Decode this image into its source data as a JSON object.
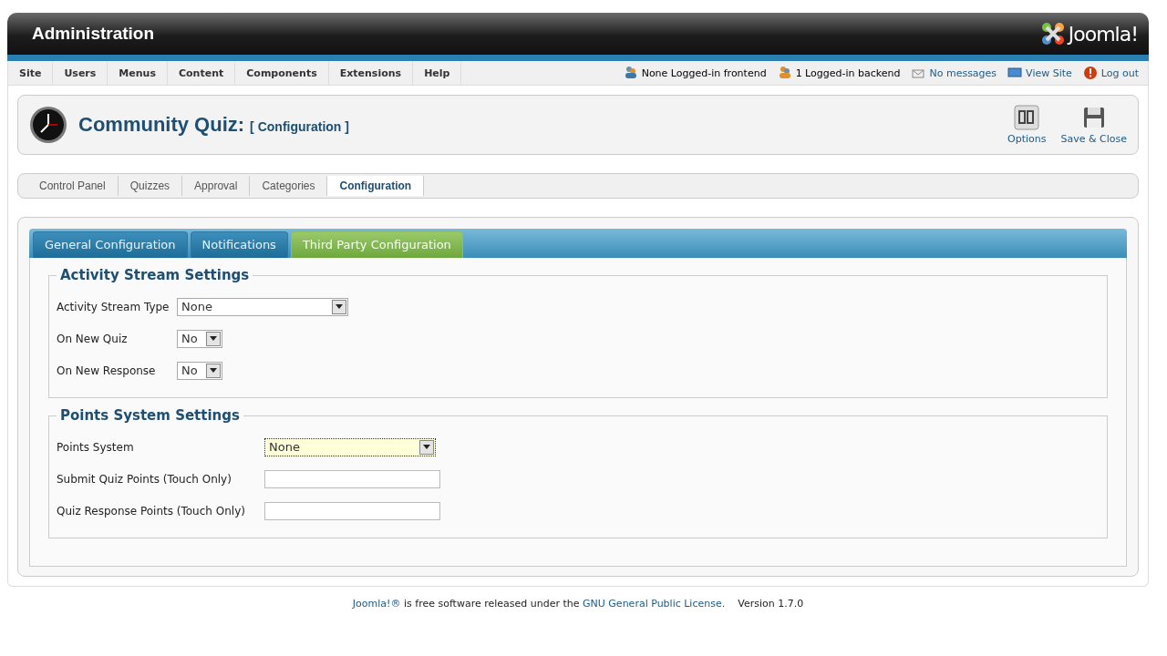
{
  "header": {
    "title": "Administration",
    "logo": "Joomla!"
  },
  "menu": [
    "Site",
    "Users",
    "Menus",
    "Content",
    "Components",
    "Extensions",
    "Help"
  ],
  "status": [
    {
      "text": "None Logged-in frontend",
      "kind": "info"
    },
    {
      "text": "1 Logged-in backend",
      "kind": "info"
    },
    {
      "text": "No messages",
      "kind": "link"
    },
    {
      "text": "View Site",
      "kind": "link"
    },
    {
      "text": "Log out",
      "kind": "link"
    }
  ],
  "toolbar": {
    "title": "Community Quiz:",
    "subtitle": "[ Configuration ]",
    "buttons": [
      "Options",
      "Save & Close"
    ]
  },
  "submenu": [
    {
      "label": "Control Panel",
      "selected": false
    },
    {
      "label": "Quizzes",
      "selected": false
    },
    {
      "label": "Approval",
      "selected": false
    },
    {
      "label": "Categories",
      "selected": false
    },
    {
      "label": "Configuration",
      "selected": true
    }
  ],
  "tabs": [
    {
      "label": "General Configuration",
      "selected": false
    },
    {
      "label": "Notifications",
      "selected": false
    },
    {
      "label": "Third Party Configuration",
      "selected": true
    }
  ],
  "fieldsets": [
    {
      "legend": "Activity Stream Settings",
      "rows": [
        {
          "label": "Activity Stream Type",
          "kind": "select",
          "value": "None",
          "focused": false
        },
        {
          "label": "On New Quiz",
          "kind": "select",
          "value": "No",
          "focused": false
        },
        {
          "label": "On New Response",
          "kind": "select",
          "value": "No",
          "focused": false
        }
      ]
    },
    {
      "legend": "Points System Settings",
      "rows": [
        {
          "label": "Points System",
          "kind": "select",
          "value": "None",
          "focused": true
        },
        {
          "label": "Submit Quiz Points (Touch Only)",
          "kind": "text"
        },
        {
          "label": "Quiz Response Points (Touch Only)",
          "kind": "text"
        }
      ]
    }
  ],
  "footer": {
    "link": "Joomla!®",
    "text": " is free software released under the ",
    "license": "GNU General Public License.",
    "version": "Version 1.7.0"
  }
}
